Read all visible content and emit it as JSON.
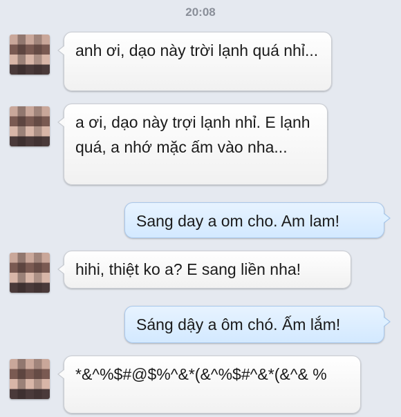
{
  "header": {
    "timestamp": "20:08"
  },
  "messages": [
    {
      "direction": "incoming",
      "text": "anh ơi, dạo này trời lạnh quá nhỉ..."
    },
    {
      "direction": "incoming",
      "text": "a ơi, dạo này trợi lạnh nhỉ. E lạnh quá, a nhớ mặc ấm vào nha..."
    },
    {
      "direction": "outgoing",
      "text": "Sang day a om cho. Am lam!"
    },
    {
      "direction": "incoming",
      "text": "hihi, thiệt ko a? E sang liền nha!"
    },
    {
      "direction": "outgoing",
      "text": "Sáng dậy a ôm chó. Ấm lắm!"
    },
    {
      "direction": "incoming",
      "text": "*&^%$#@$%^&*(&^%$#^&*(&^& %"
    }
  ],
  "colors": {
    "background": "#e5e9f0",
    "incoming_bubble": "#ffffff",
    "outgoing_bubble": "#d3e9ff"
  }
}
